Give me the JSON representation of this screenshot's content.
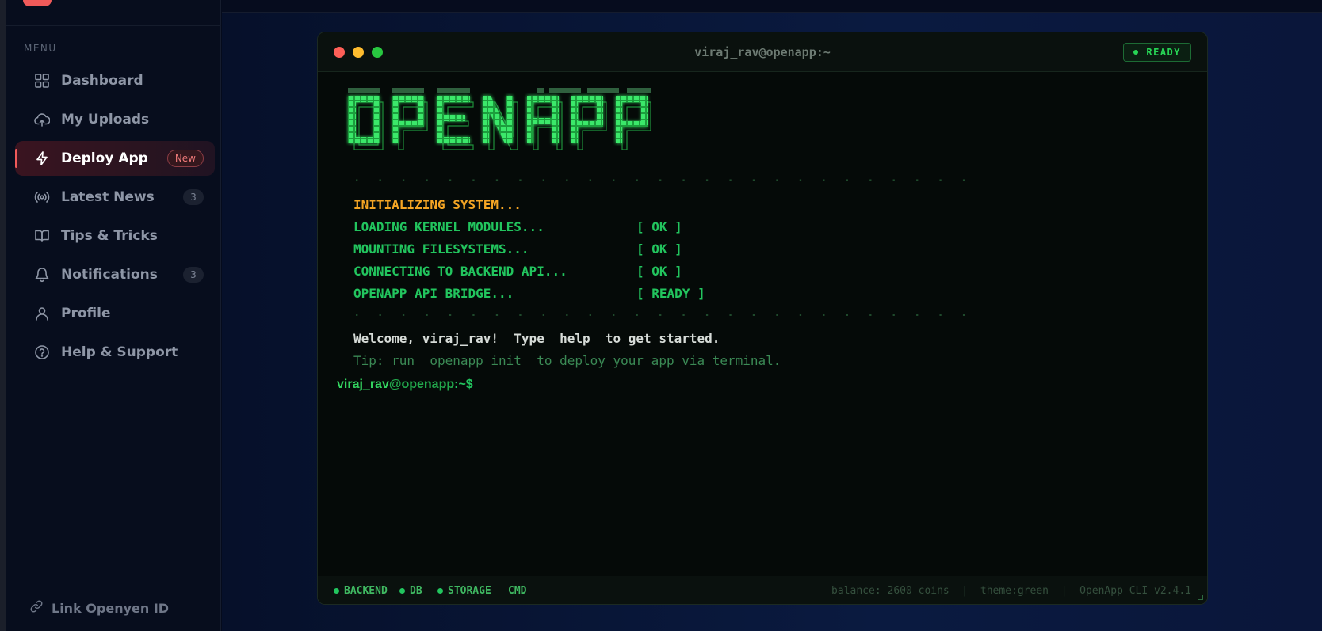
{
  "sidebar": {
    "menu_label": "MENU",
    "items": [
      {
        "label": "Dashboard",
        "icon": "grid-icon"
      },
      {
        "label": "My Uploads",
        "icon": "cloud-upload-icon"
      },
      {
        "label": "Deploy App",
        "icon": "lightning-icon",
        "badge": "New",
        "active": true
      },
      {
        "label": "Latest News",
        "icon": "broadcast-icon",
        "count": "3"
      },
      {
        "label": "Tips & Tricks",
        "icon": "book-icon"
      },
      {
        "label": "Notifications",
        "icon": "bell-icon",
        "count": "3"
      },
      {
        "label": "Profile",
        "icon": "user-icon"
      },
      {
        "label": "Help & Support",
        "icon": "help-circle-icon"
      }
    ],
    "footer_link": "Link Openyen ID"
  },
  "terminal": {
    "title": "viraj_rav@openapp:~",
    "status_pill": "READY",
    "ascii_logo": "OPENAPP",
    "separator": ". . . . . . . . . . . . . . . . . . . . . . . . . . .",
    "init_line": "INITIALIZING SYSTEM...",
    "boot_lines": [
      {
        "text": "LOADING KERNEL MODULES...",
        "status": "[ OK ]"
      },
      {
        "text": "MOUNTING FILESYSTEMS...",
        "status": "[ OK ]"
      },
      {
        "text": "CONNECTING TO BACKEND API...",
        "status": "[ OK ]"
      },
      {
        "text": "OPENAPP API BRIDGE...",
        "status": "[ READY ]"
      }
    ],
    "welcome": "Welcome, viraj_rav!  Type  help  to get started.",
    "tip": "Tip: run  openapp init  to deploy your app via terminal.",
    "prompt": {
      "user": "viraj_rav",
      "host": "@openapp",
      "path": ":~$"
    },
    "footer": {
      "services": [
        "BACKEND",
        "DB",
        "STORAGE"
      ],
      "cmd": "CMD",
      "right": "balance: 2600 coins  |  theme:green  |  OpenApp CLI v2.4.1"
    }
  },
  "colors": {
    "accent": "#ef5a5a",
    "terminal_green": "#22c55e",
    "init_orange": "#f5a524"
  }
}
